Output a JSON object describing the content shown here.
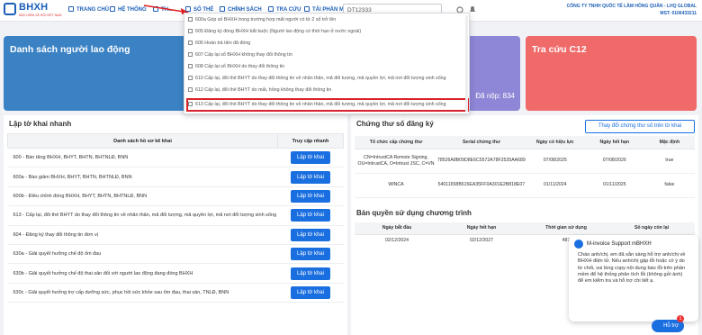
{
  "header": {
    "logo_text": "BHXH",
    "logo_sub": "BẢO HIỂM XÃ HỘI VIỆT NAM",
    "nav": [
      {
        "label": "TRANG CHỦ"
      },
      {
        "label": "HỆ THỐNG"
      },
      {
        "label": "TH..."
      },
      {
        "label": "SỐ THẺ"
      },
      {
        "label": "CHÍNH SÁCH"
      },
      {
        "label": "TRA CỨU"
      },
      {
        "label": "TẢI PHẦN MỀM KÝ"
      }
    ],
    "tax_code": "DT12333",
    "company_name": "CÔNG TY TNHH QUỐC TẾ LÂM HỒNG QUÂN - LHQ GLOBAL",
    "company_tax": "MST: 0106433211"
  },
  "cards": {
    "labor_list": "Danh sách người lao động",
    "submitted": "Đã nộp: 834",
    "lookup": "Tra cứu C12"
  },
  "dropdown": {
    "items": [
      "600a Góp số BHXH trong trường hợp mất người có từ 2 số trở lên",
      "605 Đăng ký đóng BHXH bắt buộc (Người lao động có thời hạn ở nước ngoài)",
      "606 Hoàn trả tiền đã đóng",
      "607 Cấp lại sổ BHXH không thay đổi thông tin",
      "608 Cấp lại sổ BHXH do thay đổi thông tin",
      "610 Cấp lại, đổi thẻ BHYT do thay đổi thông tin về nhân thân, mã đối tượng, mã quyền lợi, mã nơi đổi tượng sinh sống",
      "612 Cấp lại, đổi thẻ BHYT do mất, hỏng không thay đổi thông tin",
      "613 Cấp lại, đổi thẻ BHYT do thay đổi thông tin về nhân thân, mã đối tượng, mã quyền lợi, mã nơi đổi tượng sinh sống"
    ]
  },
  "quick": {
    "title": "Lập tờ khai nhanh",
    "col_list": "Danh sách hồ sơ kê khai",
    "col_access": "Truy cập nhanh",
    "button_label": "Lập tờ khai",
    "rows": [
      "600 - Báo tăng BHXH, BHYT, BHTN, BHTNLĐ, BNN",
      "600a - Báo giảm BHXH, BHYT, BHTN, BHTNLĐ, BNN",
      "600b - Điều chỉnh đóng BHXH, BHYT, BHTN, BHTNLĐ, BNN",
      "613 - Cấp lại, đổi thẻ BHYT do thay đổi thông tin về nhân thân, mã đối tượng, mã quyền lợi, mã nơi đổi tượng sinh sống",
      "604 - Đăng ký thay đổi thông tin đơn vị",
      "630a - Giải quyết hưởng chế độ ốm đau",
      "630b - Giải quyết hưởng chế độ thai sản đối với người lao động đang đóng BHXH",
      "630c - Giải quyết hưởng trợ cấp dưỡng sức, phục hồi sức khỏe sau ốm đau, thai sản, TNLĐ, BNN"
    ]
  },
  "cert": {
    "title": "Chứng thư số đăng ký",
    "change_button": "Thay đổi chứng thư số trên tờ khai",
    "headers": [
      "Tổ chức cấp chứng thư",
      "Serial chứng thư",
      "Ngày có hiệu lực",
      "Ngày hết hạn",
      "Mặc định"
    ],
    "rows": [
      {
        "issuer": "CN=IntrustCA Remote Signing, OU=IntrustCA, O=Intrust JSC, C=VN",
        "serial": "78526A8B09D8E6C5572A78F2535AA689",
        "from": "07/08/2025",
        "to": "07/08/2026",
        "default": "true"
      },
      {
        "issuer": "WINCA",
        "serial": "54011658B615EA35FF0A301E2B818E07",
        "from": "01/11/2024",
        "to": "01/11/2025",
        "default": "false"
      }
    ]
  },
  "license": {
    "title": "Bản quyền sử dụng chương trình",
    "headers": [
      "Ngày bắt đầu",
      "Ngày hết hạn",
      "Thời gian sử dụng",
      "Số ngày còn lại"
    ],
    "row": {
      "start": "02/12/2024",
      "end": "02/12/2027",
      "duration": "487"
    }
  },
  "chat": {
    "title": "M-invoice Support mBHXH",
    "message": "Chào anh/chị, em đã sẵn sàng hỗ trợ anh/chị về BHXH điện tử. Nếu anh/chị gặp lỗi hoặc có ý do từ chối, vui lòng copy nội dung báo lỗi trên phần mềm để hệ thống phân tích lỗi (không gửi ảnh) để em kiểm tra và hỗ trợ chi tiết ạ.",
    "bubble": "Hỗ trợ",
    "badge": "1"
  },
  "colors": {
    "primary": "#1c5fb8",
    "button": "#1a6fe0",
    "card_blue": "#3b82c4",
    "card_purple": "#8e86d6",
    "card_red": "#f06a6a",
    "highlight": "#d8232a"
  }
}
